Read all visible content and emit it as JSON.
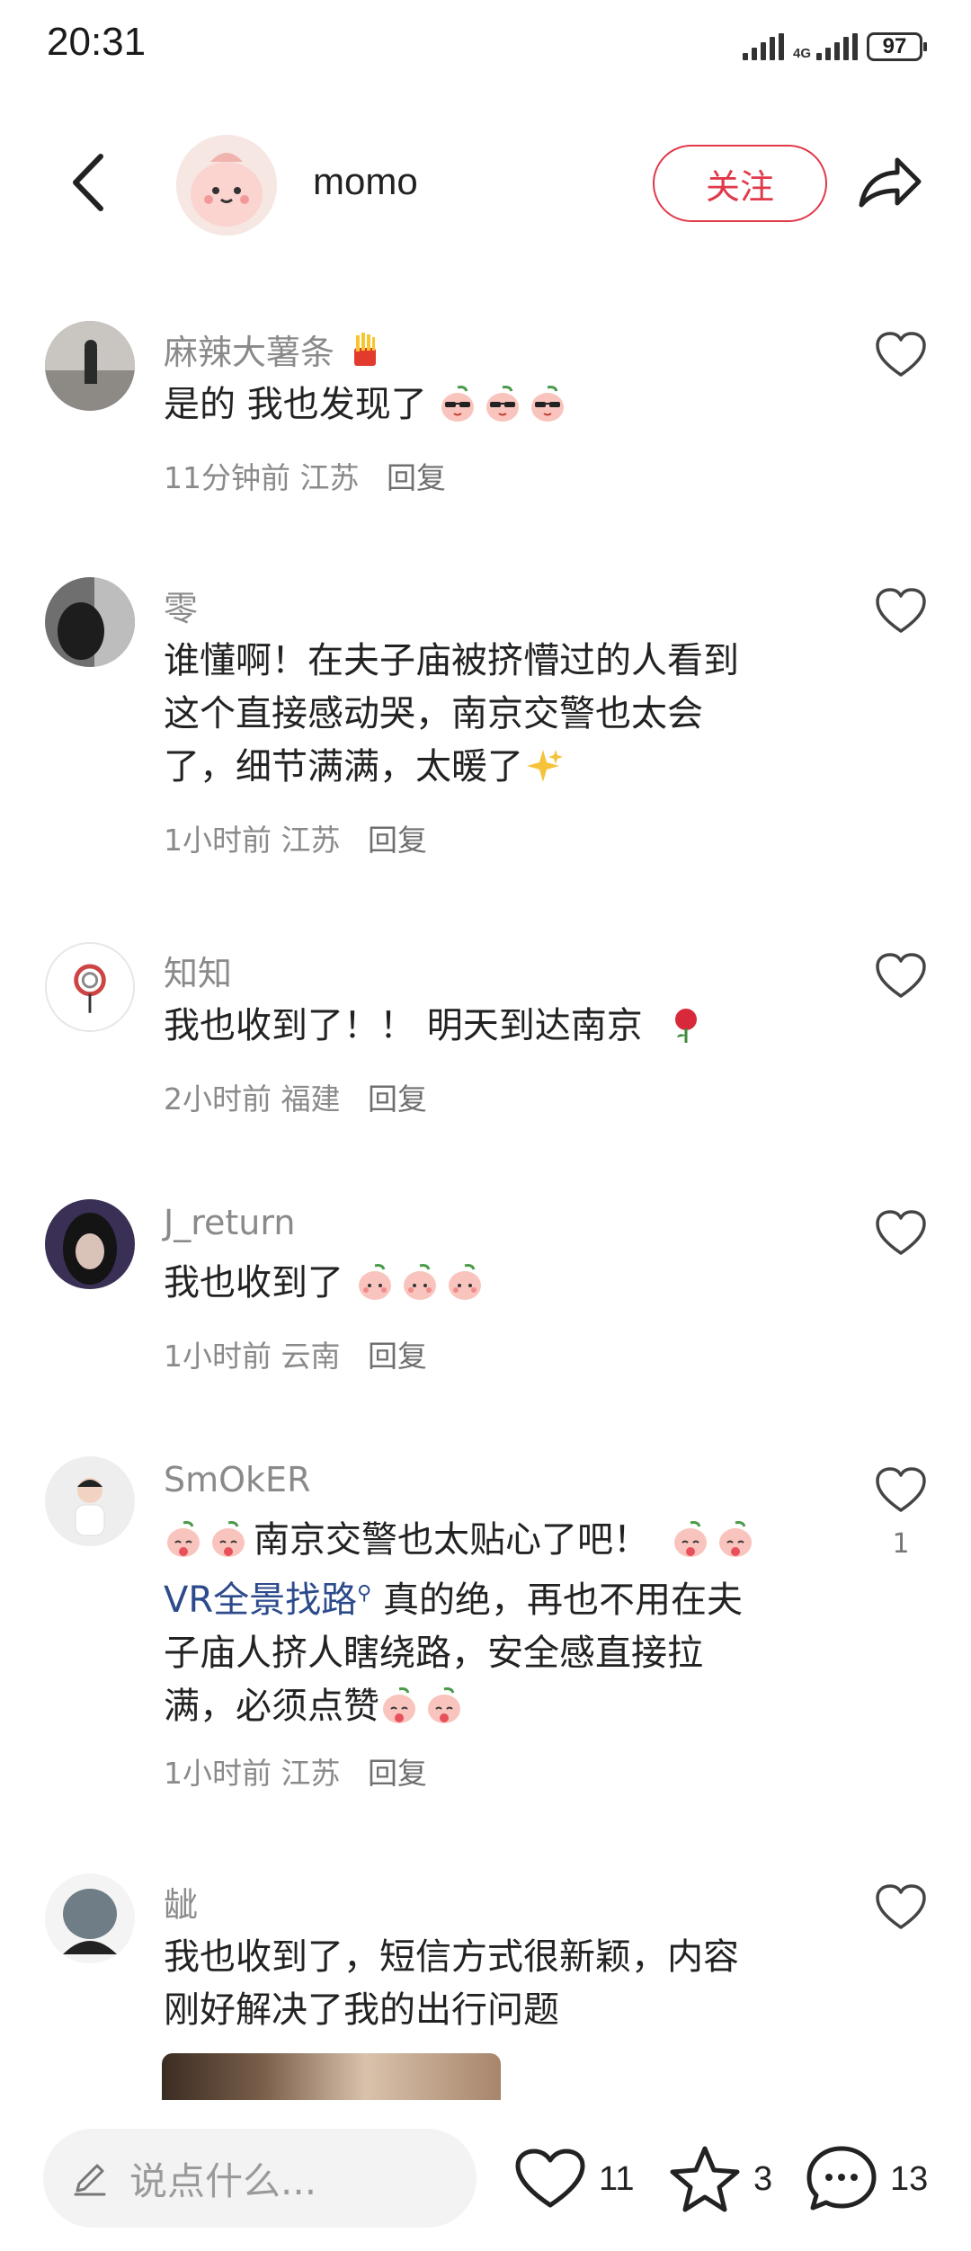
{
  "status_bar": {
    "time": "20:31",
    "network": "4G",
    "battery": "97"
  },
  "header": {
    "author": "momo",
    "follow_label": "关注"
  },
  "comments": [
    {
      "user": "麻辣大薯条",
      "user_emoji": "fries-emoji",
      "text": "是的 我也发现了",
      "text_emojis": [
        "sunglasses-peach-emoji",
        "sunglasses-peach-emoji",
        "sunglasses-peach-emoji"
      ],
      "time": "11分钟前",
      "location": "江苏",
      "reply": "回复"
    },
    {
      "user": "零",
      "lines": [
        "谁懂啊！在夫子庙被挤懵过的人看到",
        "这个直接感动哭，南京交警也太会",
        "了，细节满满，太暖了"
      ],
      "text_emojis": [
        "sparkles-emoji"
      ],
      "time": "1小时前",
      "location": "江苏",
      "reply": "回复"
    },
    {
      "user": "知知",
      "text": "我也收到了！！ 明天到达南京",
      "text_emojis": [
        "rose-emoji"
      ],
      "time": "2小时前",
      "location": "福建",
      "reply": "回复"
    },
    {
      "user": "J_return",
      "text": "我也收到了",
      "text_emojis": [
        "peach-face-emoji",
        "peach-face-emoji",
        "peach-face-emoji"
      ],
      "time": "1小时前",
      "location": "云南",
      "reply": "回复"
    },
    {
      "user": "SmOkER",
      "line1": "南京交警也太贴心了吧！",
      "link": "VR全景找路",
      "line2_rest": " 真的绝，再也不用在夫",
      "line3": "子庙人挤人瞎绕路，安全感直接拉",
      "line4": "满，必须点赞",
      "time": "1小时前",
      "location": "江苏",
      "reply": "回复",
      "likes": "1"
    },
    {
      "user": "龇",
      "lines": [
        "我也收到了，短信方式很新颖，内容",
        "刚好解决了我的出行问题"
      ]
    }
  ],
  "bottom_bar": {
    "placeholder": "说点什么...",
    "likes": "11",
    "favorites": "3",
    "comments": "13"
  },
  "colors": {
    "accent": "#e0394a",
    "link": "#2c4a8c",
    "meta": "#8a8a8a"
  }
}
